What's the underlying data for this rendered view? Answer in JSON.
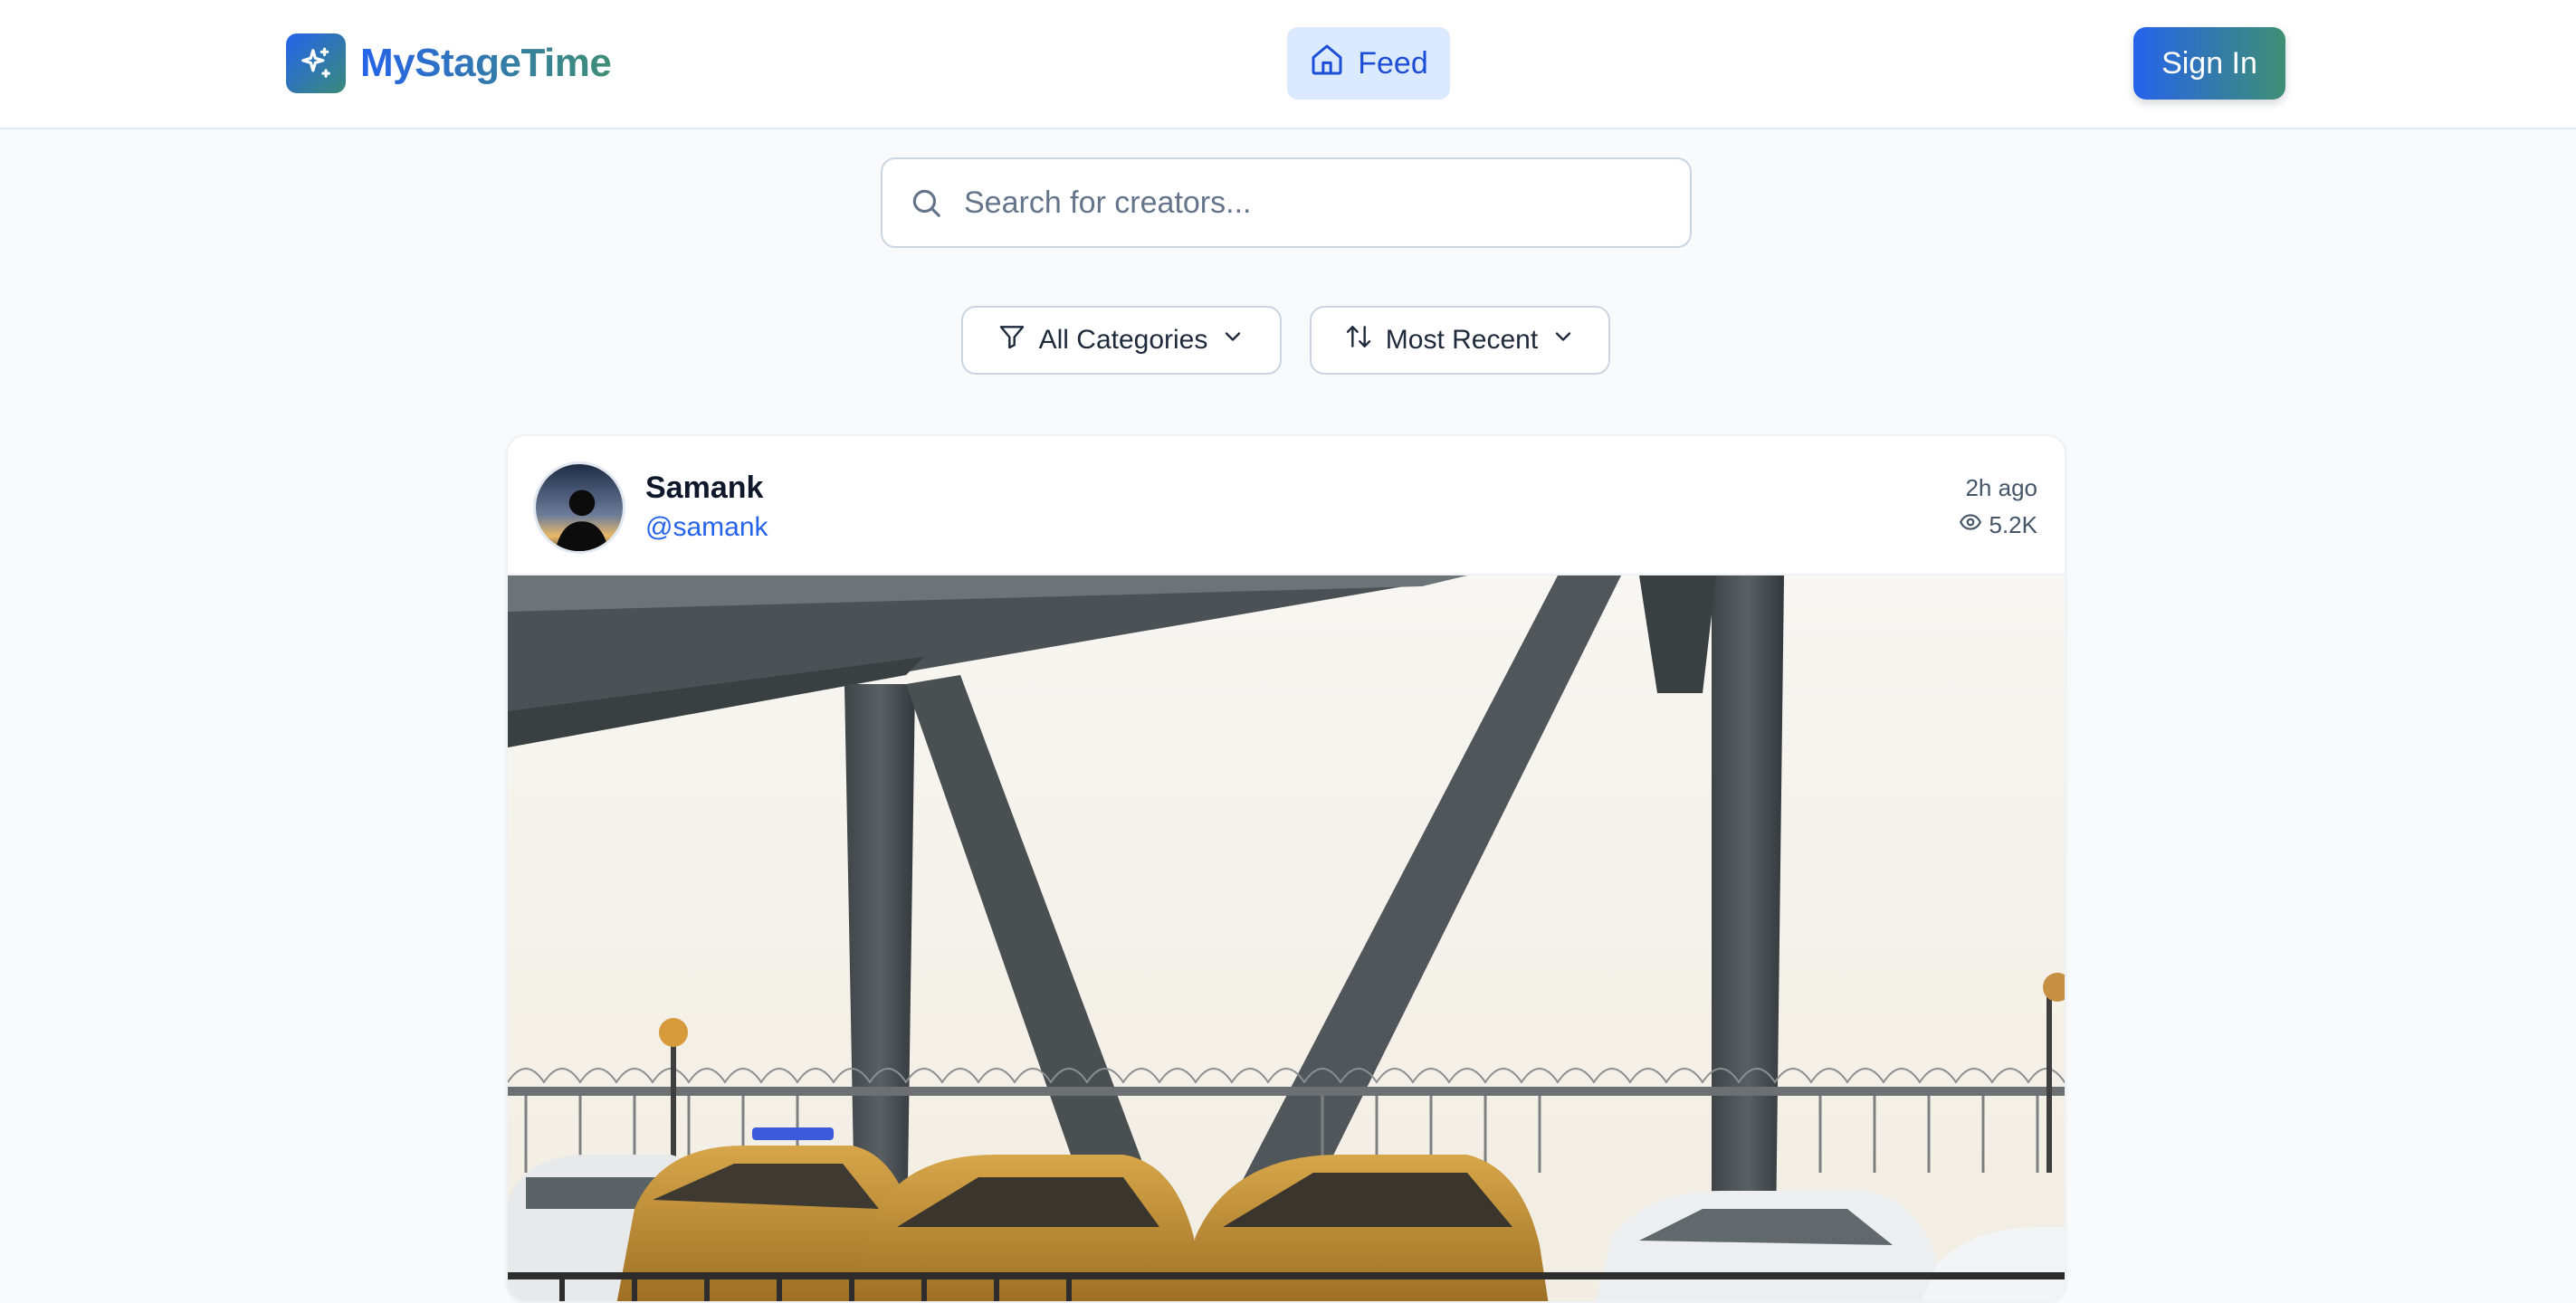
{
  "app": {
    "name": "MyStageTime",
    "logo_icon": "sparkles-icon",
    "accent": "#2563eb",
    "accent_secondary": "#3f8f74"
  },
  "nav": {
    "feed_label": "Feed",
    "feed_icon": "home-icon",
    "sign_in_label": "Sign In"
  },
  "search": {
    "placeholder": "Search for creators...",
    "value": "",
    "icon": "search-icon"
  },
  "filters": {
    "category": {
      "label": "All Categories",
      "icon": "filter-icon"
    },
    "sort": {
      "label": "Most Recent",
      "icon": "sort-icon"
    }
  },
  "post": {
    "author_name": "Samank",
    "author_handle": "@samank",
    "time": "2h ago",
    "views": "5.2K",
    "views_icon": "eye-icon",
    "image_subject": "yellow taxis on steel truss bridge"
  }
}
